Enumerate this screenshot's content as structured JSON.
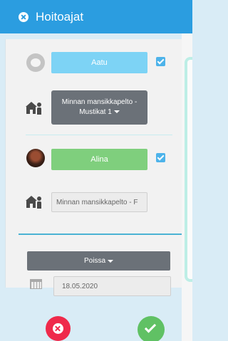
{
  "header": {
    "title": "Hoitoajat"
  },
  "children": [
    {
      "name": "Aatu",
      "color": "#7dd3f5",
      "selected": true,
      "group": {
        "line1": "Minnan mansikkapelto -",
        "line2": "Mustikat 1"
      }
    },
    {
      "name": "Alina",
      "color": "#7fcf7d",
      "selected": true,
      "group_value": "Minnan mansikkapelto - F"
    }
  ],
  "status": {
    "selected": "Poissa"
  },
  "date": {
    "value": "18.05.2020"
  },
  "icons": {
    "close": "close-circle-icon",
    "group": "daycare-group-icon",
    "calendar": "calendar-icon",
    "cancel": "cancel-x-icon",
    "confirm": "check-icon"
  },
  "colors": {
    "header": "#2b9de0",
    "cancel": "#ef2a4b",
    "confirm": "#60c164",
    "dropdown": "#6b7178"
  }
}
